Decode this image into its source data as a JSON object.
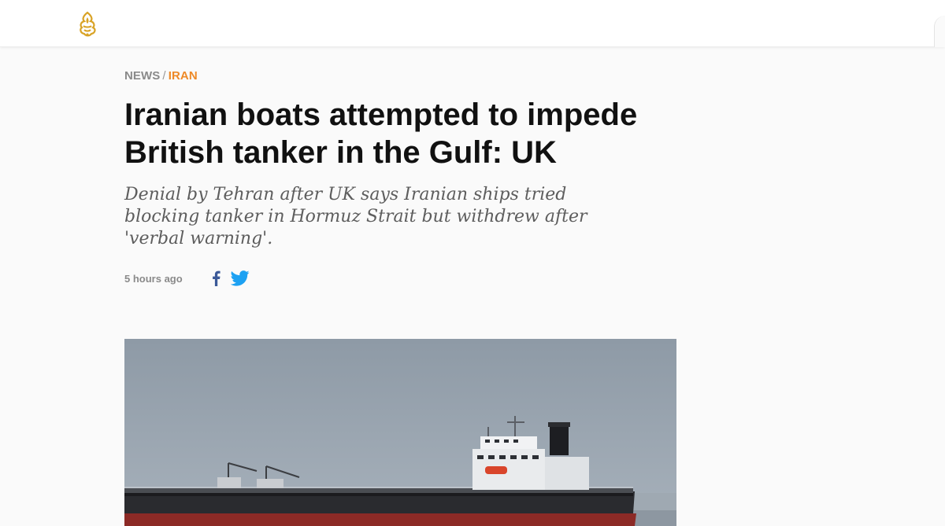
{
  "header": {
    "logo_icon": "al-jazeera-logo-icon"
  },
  "breadcrumb": {
    "section": "NEWS",
    "separator": "/",
    "topic": "IRAN"
  },
  "article": {
    "headline": "Iranian boats attempted to impede British tanker in the Gulf: UK",
    "subheadline": "Denial by Tehran after UK says Iranian ships tried blocking tanker in Hormuz Strait but withdrew after 'verbal warning'.",
    "timestamp": "5 hours ago"
  },
  "share": {
    "facebook_icon": "facebook-icon",
    "twitter_icon": "twitter-icon"
  },
  "hero_image": {
    "subject": "oil tanker at sea"
  },
  "colors": {
    "accent": "#ee8a27",
    "headline": "#111111",
    "meta": "#8a8a8a",
    "facebook": "#3b5998",
    "twitter": "#1da1f2",
    "logo_gold": "#d9a326"
  }
}
